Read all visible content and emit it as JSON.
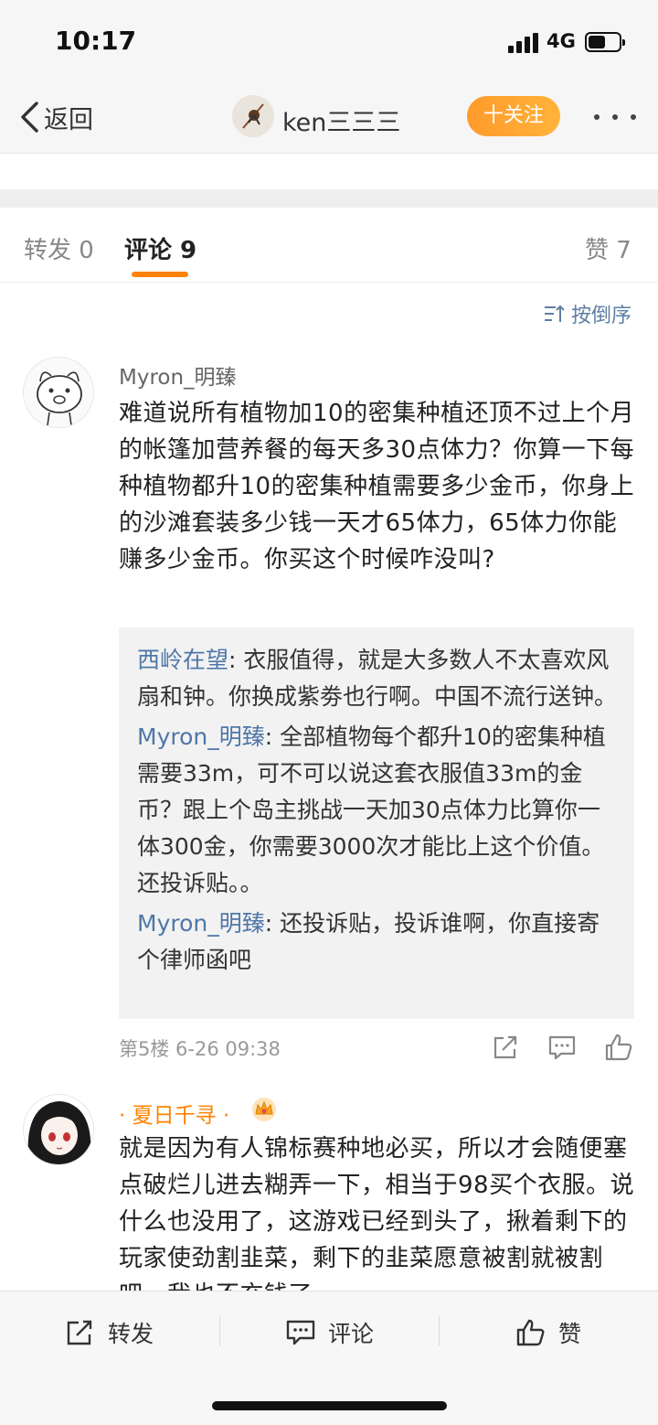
{
  "status_bar": {
    "time": "10:17",
    "network": "4G",
    "battery_level": 0.55
  },
  "nav": {
    "back_label": "返回",
    "username": "ken三三三",
    "follow_label": "十关注"
  },
  "tabs": [
    {
      "label": "转发 0"
    },
    {
      "label": "评论 9"
    },
    {
      "label": "赞 7"
    }
  ],
  "sort_label": "按倒序",
  "comments": [
    {
      "name": "Myron_明臻",
      "text": "难道说所有植物加10的密集种植还顶不过上个月的帐篷加营养餐的每天多30点体力？你算一下每种植物都升10的密集种植需要多少金币，你身上的沙滩套装多少钱一天才65体力，65体力你能赚多少金币。你买这个时候咋没叫?",
      "replies": [
        {
          "who": "西岭在望",
          "text": ": 衣服值得，就是大多数人不太喜欢风扇和钟。你换成紫劵也行啊。中国不流行送钟。"
        },
        {
          "who": "Myron_明臻",
          "text": ": 全部植物每个都升10的密集种植需要33m，可不可以说这套衣服值33m的金币？跟上个岛主挑战一天加30点体力比算你一体300金，你需要3000次才能比上这个价值。还投诉贴。。"
        },
        {
          "who": "Myron_明臻",
          "text": ": 还投诉贴，投诉谁啊，你直接寄个律师函吧"
        }
      ],
      "meta": "第5楼 6-26 09:38"
    },
    {
      "name": "· 夏日千寻 ·",
      "text": "就是因为有人锦标赛种地必买，所以才会随便塞点破烂儿进去糊弄一下，相当于98买个衣服。说什么也没用了，这游戏已经到头了，揪着剩下的玩家使劲割韭菜，剩下的韭菜愿意被割就被割吧，我也不充钱了"
    }
  ],
  "bottom_bar": {
    "repost": "转发",
    "comment": "评论",
    "like": "赞"
  },
  "colors": {
    "accent": "#ff8200",
    "link": "#4f77a8",
    "sort": "#5e7fa6"
  }
}
